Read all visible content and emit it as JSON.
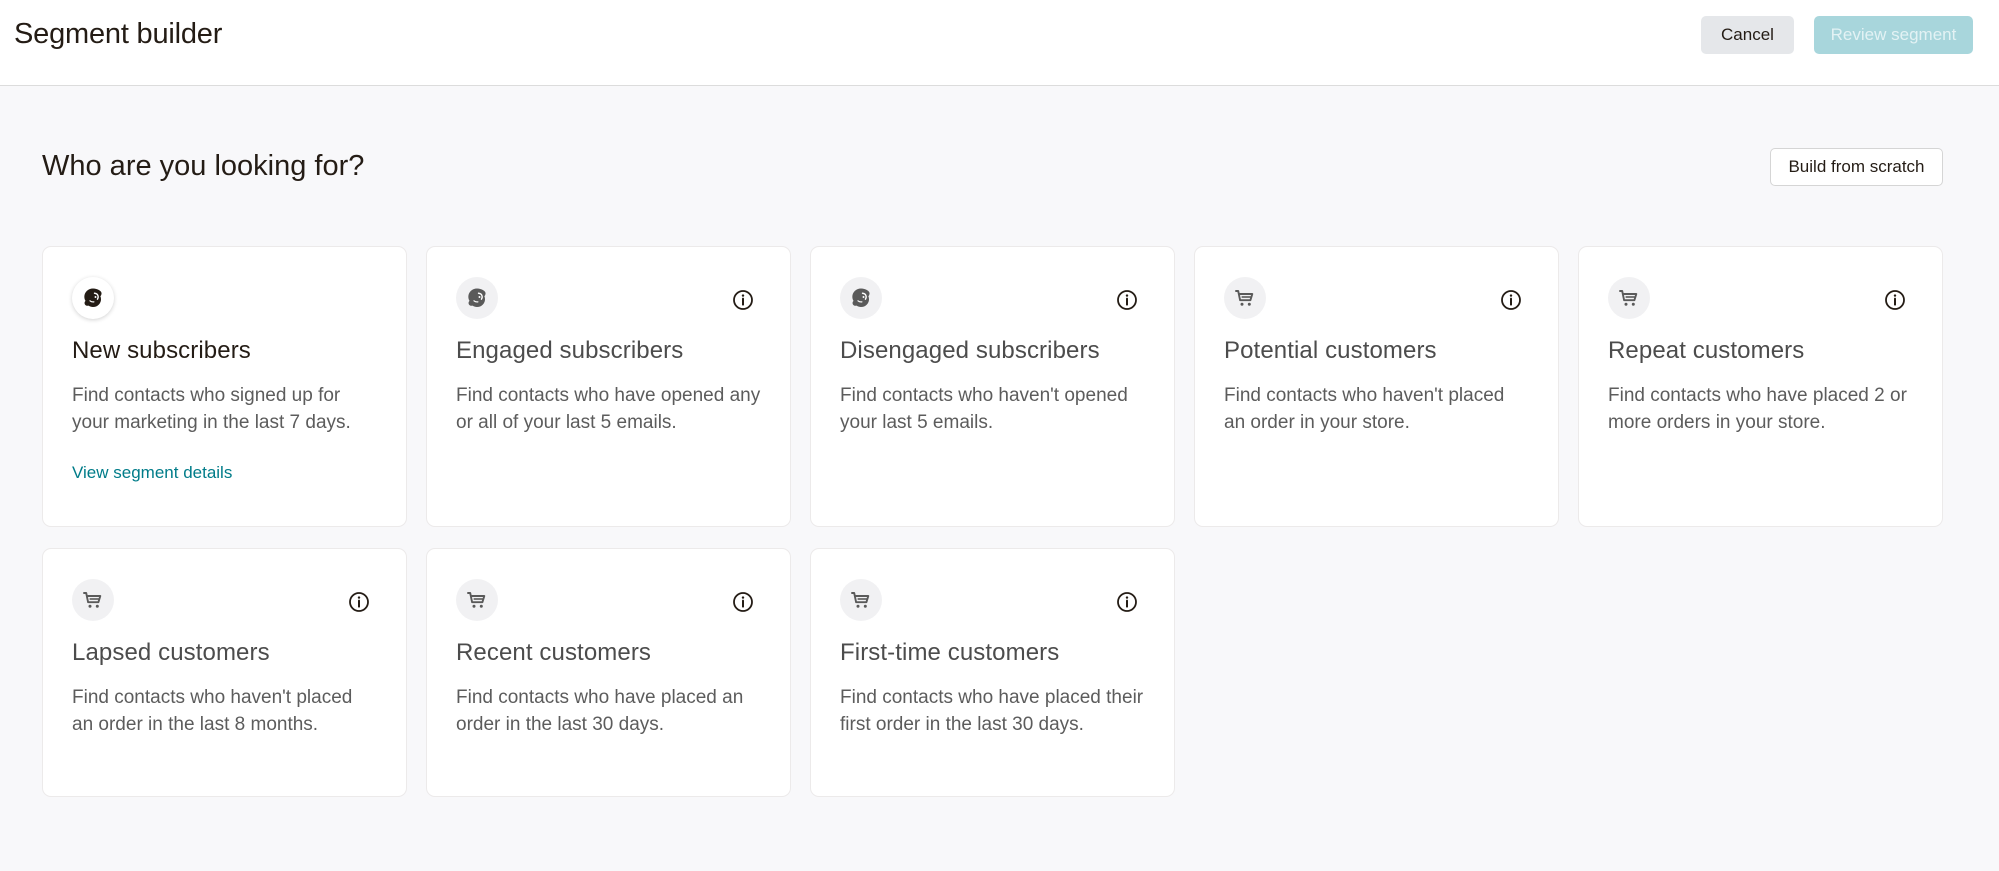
{
  "header": {
    "title": "Segment builder",
    "cancel_label": "Cancel",
    "review_label": "Review segment"
  },
  "main": {
    "heading": "Who are you looking for?",
    "build_from_scratch_label": "Build from scratch"
  },
  "cards": [
    {
      "icon": "mailchimp-logo-icon",
      "title": "New subscribers",
      "description": "Find contacts who signed up for your marketing in the last 7 days.",
      "link": "View segment details"
    },
    {
      "icon": "mailchimp-logo-icon",
      "title": "Engaged subscribers",
      "description": "Find contacts who have opened any or all of your last 5 emails."
    },
    {
      "icon": "mailchimp-logo-icon",
      "title": "Disengaged subscribers",
      "description": "Find contacts who haven't opened your last 5 emails."
    },
    {
      "icon": "cart-icon",
      "title": "Potential customers",
      "description": "Find contacts who haven't placed an order in your store."
    },
    {
      "icon": "cart-icon",
      "title": "Repeat customers",
      "description": "Find contacts who have placed 2 or more orders in your store."
    },
    {
      "icon": "cart-icon",
      "title": "Lapsed customers",
      "description": "Find contacts who haven't placed an order in the last 8 months."
    },
    {
      "icon": "cart-icon",
      "title": "Recent customers",
      "description": "Find contacts who have placed an order in the last 30 days."
    },
    {
      "icon": "cart-icon",
      "title": "First-time customers",
      "description": "Find contacts who have placed their first order in the last 30 days."
    }
  ],
  "colors": {
    "accent_link": "#007c89",
    "primary_disabled": "#a8d6dc",
    "background": "#f8f8fa"
  }
}
